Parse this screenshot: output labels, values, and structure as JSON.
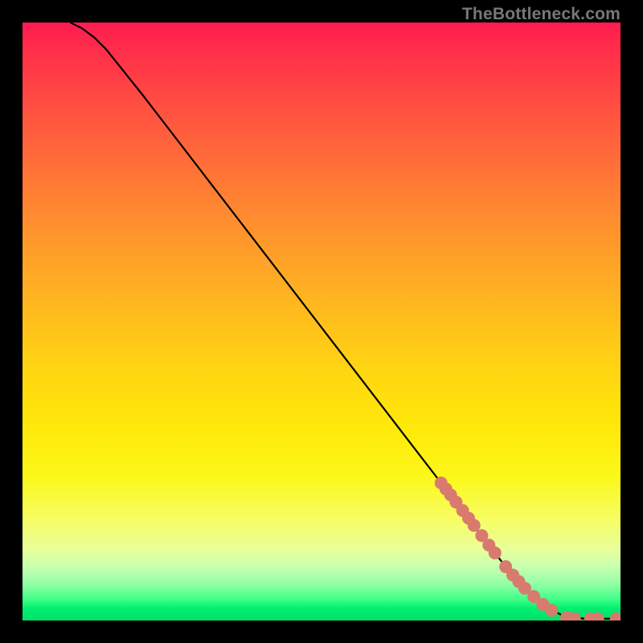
{
  "attribution": "TheBottleneck.com",
  "plot": {
    "background_gradient": {
      "top": "#ff1c51",
      "mid": "#ffe909",
      "bottom": "#00e06a"
    },
    "line_color": "#000000",
    "marker_color": "#d97a6f",
    "marker_radius": 8
  },
  "chart_data": {
    "type": "line",
    "title": "",
    "xlabel": "",
    "ylabel": "",
    "xlim": [
      0,
      100
    ],
    "ylim": [
      0,
      100
    ],
    "series": [
      {
        "name": "curve",
        "x": [
          8,
          10,
          12,
          14,
          16,
          20,
          25,
          30,
          35,
          40,
          45,
          50,
          55,
          60,
          65,
          70,
          75,
          80,
          85,
          88,
          90,
          92,
          94,
          96,
          98,
          100
        ],
        "y": [
          100,
          99,
          97.5,
          95.5,
          93,
          88,
          81.5,
          75,
          68.5,
          62,
          55.5,
          49,
          42.5,
          36,
          29.5,
          23,
          16.5,
          10,
          4.5,
          2,
          1,
          0.5,
          0.3,
          0.3,
          0.3,
          0.3
        ]
      }
    ],
    "markers": [
      {
        "x": 70.0,
        "y": 23.0
      },
      {
        "x": 70.8,
        "y": 22.0
      },
      {
        "x": 71.6,
        "y": 21.0
      },
      {
        "x": 72.5,
        "y": 19.8
      },
      {
        "x": 73.6,
        "y": 18.4
      },
      {
        "x": 74.6,
        "y": 17.1
      },
      {
        "x": 75.5,
        "y": 15.9
      },
      {
        "x": 76.8,
        "y": 14.2
      },
      {
        "x": 78.0,
        "y": 12.6
      },
      {
        "x": 79.0,
        "y": 11.3
      },
      {
        "x": 80.8,
        "y": 9.0
      },
      {
        "x": 82.0,
        "y": 7.6
      },
      {
        "x": 83.0,
        "y": 6.5
      },
      {
        "x": 84.0,
        "y": 5.4
      },
      {
        "x": 85.5,
        "y": 4.0
      },
      {
        "x": 87.0,
        "y": 2.7
      },
      {
        "x": 88.5,
        "y": 1.7
      },
      {
        "x": 91.0,
        "y": 0.5
      },
      {
        "x": 92.3,
        "y": 0.3
      },
      {
        "x": 95.0,
        "y": 0.3
      },
      {
        "x": 96.2,
        "y": 0.3
      },
      {
        "x": 99.3,
        "y": 0.3
      }
    ]
  }
}
